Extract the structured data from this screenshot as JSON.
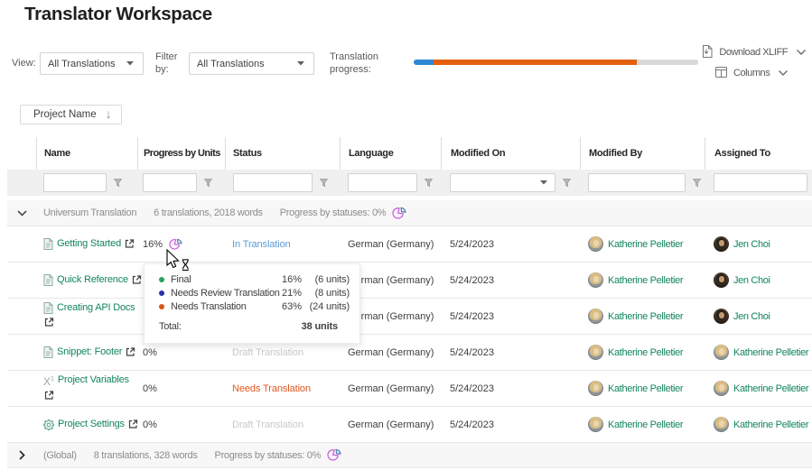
{
  "page": {
    "title": "Translator Workspace"
  },
  "toolbar": {
    "view_label": "View:",
    "view_value": "All Translations",
    "filter_label": "Filter by:",
    "filter_value": "All Translations",
    "progress_label": "Translation progress:",
    "progress_bar": {
      "segments": [
        {
          "name": "final",
          "color": "#2f86d3",
          "pct": 7
        },
        {
          "name": "needs-translation",
          "color": "#e4600f",
          "pct": 71.5
        },
        {
          "name": "remaining",
          "color": "#d9d9d9",
          "pct": 21.5
        }
      ]
    },
    "download_label": "Download XLIFF",
    "columns_label": "Columns"
  },
  "grouping": {
    "chip_label": "Project Name"
  },
  "grid": {
    "columns": [
      "Name",
      "Progress by Units",
      "Status",
      "Language",
      "Modified On",
      "Modified By",
      "Assigned To"
    ],
    "groups": [
      {
        "name": "Universum Translation",
        "summary": "6 translations, 2018 words",
        "statuses_label": "Progress by statuses: 0%",
        "expanded": true
      },
      {
        "name": "(Global)",
        "summary": "8 translations, 328 words",
        "statuses_label": "Progress by statuses: 0%",
        "expanded": false
      }
    ],
    "rows": [
      {
        "icon": "document",
        "name": "Getting Started",
        "progress": "16%",
        "status": "In Translation",
        "status_color": "#5b9bd5",
        "language": "German (Germany)",
        "modified_on": "5/24/2023",
        "modified_by": "Katherine Pelletier",
        "assigned_to": "Jen Choi"
      },
      {
        "icon": "document",
        "name": "Quick Reference",
        "progress": "",
        "status": "",
        "status_color": "",
        "language": "German (Germany)",
        "modified_on": "5/24/2023",
        "modified_by": "Katherine Pelletier",
        "assigned_to": "Jen Choi"
      },
      {
        "icon": "document",
        "name": "Creating API Docs",
        "progress": "",
        "status": "",
        "status_color": "",
        "language": "German (Germany)",
        "modified_on": "5/24/2023",
        "modified_by": "Katherine Pelletier",
        "assigned_to": "Jen Choi"
      },
      {
        "icon": "document",
        "name": "Snippet: Footer",
        "progress": "0%",
        "status": "Draft Translation",
        "status_color": "#c9c9c9",
        "language": "German (Germany)",
        "modified_on": "5/24/2023",
        "modified_by": "Katherine Pelletier",
        "assigned_to": "Katherine Pelletier"
      },
      {
        "icon": "variables",
        "name": "Project Variables",
        "progress": "0%",
        "status": "Needs Translation",
        "status_color": "#e0561f",
        "language": "German (Germany)",
        "modified_on": "5/24/2023",
        "modified_by": "Katherine Pelletier",
        "assigned_to": "Katherine Pelletier"
      },
      {
        "icon": "settings",
        "name": "Project Settings",
        "progress": "0%",
        "status": "Draft Translation",
        "status_color": "#c9c9c9",
        "language": "German (Germany)",
        "modified_on": "5/24/2023",
        "modified_by": "Katherine Pelletier",
        "assigned_to": "Katherine Pelletier"
      }
    ]
  },
  "tooltip": {
    "items": [
      {
        "label": "Final",
        "dot_color": "#2aa060",
        "percent": "16%",
        "units": "(6 units)"
      },
      {
        "label": "Needs Review Translation",
        "dot_color": "#2b31a3",
        "percent": "21%",
        "units": "(8 units)"
      },
      {
        "label": "Needs Translation",
        "dot_color": "#da5616",
        "percent": "63%",
        "units": "(24 units)"
      }
    ],
    "total_label": "Total:",
    "total_value": "38 units"
  }
}
